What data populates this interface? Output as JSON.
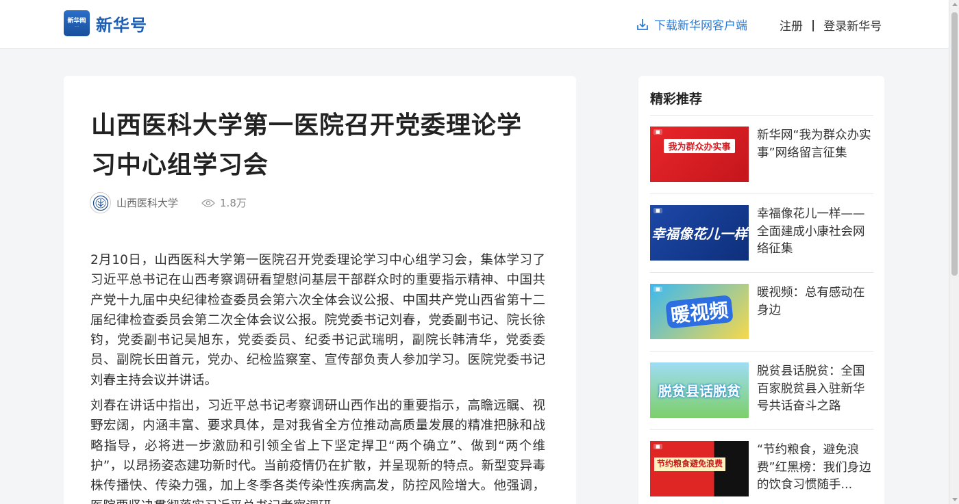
{
  "header": {
    "logo_badge": "新华网",
    "logo_text": "新华号",
    "download_label": "下载新华网客户端",
    "register_label": "注册",
    "separator": "|",
    "login_label": "登录新华号"
  },
  "article": {
    "title": "山西医科大学第一医院召开党委理论学习中心组学习会",
    "author": "山西医科大学",
    "views": "1.8万",
    "paragraphs": [
      "2月10日，山西医科大学第一医院召开党委理论学习中心组学习会，集体学习了习近平总书记在山西考察调研看望慰问基层干部群众时的重要指示精神、中国共产党十九届中央纪律检查委员会第六次全体会议公报、中国共产党山西省第十二届纪律检查委员会第二次全体会议公报。院党委书记刘春，党委副书记、院长徐钧，党委副书记吴旭东，党委委员、纪委书记武瑞明，副院长韩清华，党委委员、副院长田首元，党办、纪检监察室、宣传部负责人参加学习。医院党委书记刘春主持会议并讲话。",
      "刘春在讲话中指出，习近平总书记考察调研山西作出的重要指示，高瞻远瞩、视野宏阔，内涵丰富、要求具体，是对我省全方位推动高质量发展的精准把脉和战略指导，必将进一步激励和引领全省上下坚定捍卫“两个确立”、做到“两个维护”，以昂扬姿态建功新时代。当前疫情仍在扩散，并呈现新的特点。新型变异毒株传播快、传染力强，加上冬季各类传染性疾病高发，防控风险增大。他强调，医院要坚决贯彻落实习近平总书记考察调研"
    ]
  },
  "sidebar": {
    "heading": "精彩推荐",
    "items": [
      {
        "title": "新华网“我为群众办实事”网络留言征集",
        "thumb_text": "我为群众办实事"
      },
      {
        "title": "幸福像花儿一样——全面建成小康社会网络征集",
        "thumb_text": "幸福像花儿一样"
      },
      {
        "title": "暖视频：总有感动在身边",
        "thumb_text": "暖视频"
      },
      {
        "title": "脱贫县话脱贫：全国百家脱贫县入驻新华号共话奋斗之路",
        "thumb_text": "脱贫县话脱贫"
      },
      {
        "title": "“节约粮食，避免浪费”红黑榜：我们身边的饮食习惯随手...",
        "thumb_text": "节约粮食避免浪费"
      }
    ]
  }
}
